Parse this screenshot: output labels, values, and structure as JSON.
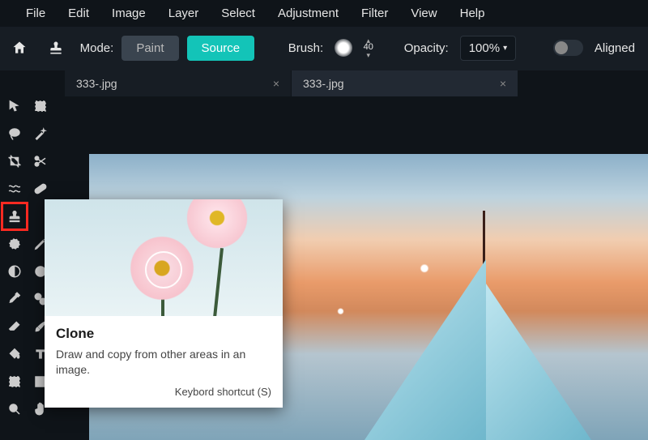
{
  "menu": {
    "items": [
      "File",
      "Edit",
      "Image",
      "Layer",
      "Select",
      "Adjustment",
      "Filter",
      "View",
      "Help"
    ]
  },
  "optbar": {
    "mode_label": "Mode:",
    "paint_label": "Paint",
    "source_label": "Source",
    "brush_label": "Brush:",
    "brush_size": "40",
    "opacity_label": "Opacity:",
    "opacity_value": "100%",
    "aligned_label": "Aligned"
  },
  "tabs": [
    {
      "label": "333-.jpg"
    },
    {
      "label": "333-.jpg"
    }
  ],
  "tools": [
    {
      "name": "arrow-tool"
    },
    {
      "name": "marquee-tool"
    },
    {
      "name": "lasso-tool"
    },
    {
      "name": "wand-tool"
    },
    {
      "name": "crop-tool"
    },
    {
      "name": "cutout-tool"
    },
    {
      "name": "liquify-tool"
    },
    {
      "name": "heal-tool"
    },
    {
      "name": "clone-tool",
      "selected": true
    },
    {
      "name": "blank-slot"
    },
    {
      "name": "disperse-tool"
    },
    {
      "name": "draw-tool"
    },
    {
      "name": "dodge-tool"
    },
    {
      "name": "toning-tool"
    },
    {
      "name": "gradient-tool"
    },
    {
      "name": "replace-color-tool"
    },
    {
      "name": "eraser-tool"
    },
    {
      "name": "pen-tool"
    },
    {
      "name": "fill-tool"
    },
    {
      "name": "type-tool"
    },
    {
      "name": "shape-tool"
    },
    {
      "name": "frame-tool"
    },
    {
      "name": "zoom-tool"
    },
    {
      "name": "hand-tool"
    }
  ],
  "tooltip": {
    "title": "Clone",
    "desc": "Draw and copy from other areas in an image.",
    "shortcut": "Keybord shortcut (S)"
  },
  "icons": {
    "home": "home-icon",
    "stamp": "stamp-icon"
  }
}
